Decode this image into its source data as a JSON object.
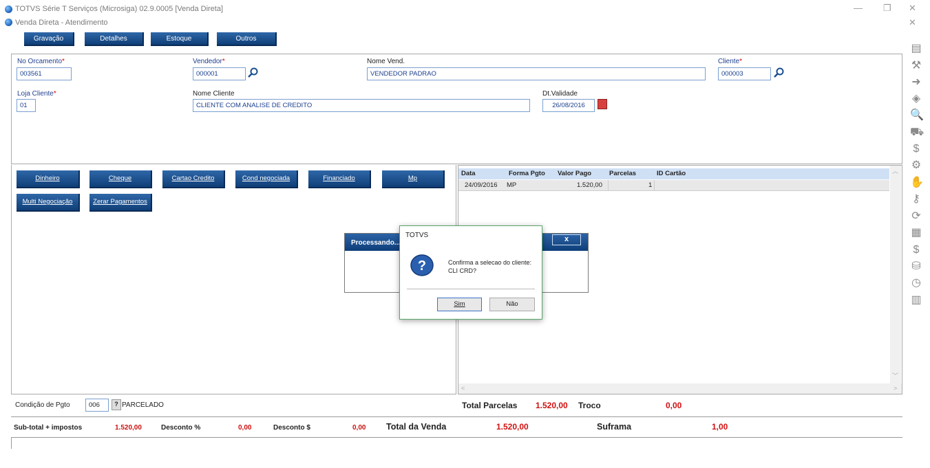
{
  "app_title": "TOTVS Série T Serviços (Microsiga) 02.9.0005 [Venda Direta]",
  "window_title": "Venda Direta - Atendimento",
  "toolbar": [
    "Gravação",
    "Detalhes",
    "Estoque",
    "Outros"
  ],
  "header": {
    "no_orcamento_label": "No Orcamento",
    "no_orcamento": "003561",
    "vendedor_label": "Vendedor",
    "vendedor": "000001",
    "nome_vend_label": "Nome Vend.",
    "nome_vend": "VENDEDOR PADRAO",
    "cliente_label": "Cliente",
    "cliente": "000003",
    "loja_label": "Loja Cliente",
    "loja": "01",
    "nome_cliente_label": "Nome Cliente",
    "nome_cliente": "CLIENTE COM ANALISE DE CREDITO",
    "validade_label": "Dt.Validade",
    "validade": "26/08/2016"
  },
  "payment_buttons": [
    "Dinheiro",
    "Cheque",
    "Cartao Credito",
    "Cond negociada",
    "Financiado",
    "Mp",
    "Multi Negociação",
    "Zerar Pagamentos"
  ],
  "grid": {
    "columns": [
      "Data",
      "Forma Pgto",
      "Valor Pago",
      "Parcelas",
      "ID Cartão"
    ],
    "rows": [
      [
        "24/09/2016",
        "MP",
        "1.520,00",
        "1",
        ""
      ]
    ]
  },
  "condicao": {
    "label": "Condição de Pgto",
    "code": "006",
    "help": "?",
    "desc": "PARCELADO"
  },
  "totals": {
    "total_parcelas_label": "Total Parcelas",
    "total_parcelas": "1.520,00",
    "troco_label": "Troco",
    "troco": "0,00"
  },
  "footer": {
    "subtotal_label": "Sub-total + impostos",
    "subtotal": "1.520,00",
    "desconto_pct_label": "Desconto %",
    "desconto_pct": "0,00",
    "desconto_val_label": "Desconto $",
    "desconto_val": "0,00",
    "total_venda_label": "Total da Venda",
    "total_venda": "1.520,00",
    "suframa_label": "Suframa",
    "suframa": "1,00"
  },
  "processando": {
    "title": "Processando...",
    "close": "x"
  },
  "dialog": {
    "title": "TOTVS",
    "message_line1": "Confirma a selecao do cliente:",
    "message_line2": "CLI CRD?",
    "yes": "Sim",
    "no": "Não"
  },
  "colors": {
    "button_blue": "#1a4f90",
    "grid_header": "#cfe0f5",
    "value_red": "#d01010",
    "dialog_border": "#5aa56a"
  },
  "sidebar_icons": [
    "save-icon",
    "tools-icon",
    "exit-icon",
    "box-icon",
    "search-doc-icon",
    "cart-icon",
    "money-icon",
    "gear-icon",
    "hand-icon",
    "key-icon",
    "refresh-icon",
    "clipboard-icon",
    "dollar-icon",
    "coins-icon",
    "clock-icon",
    "chart-icon"
  ]
}
